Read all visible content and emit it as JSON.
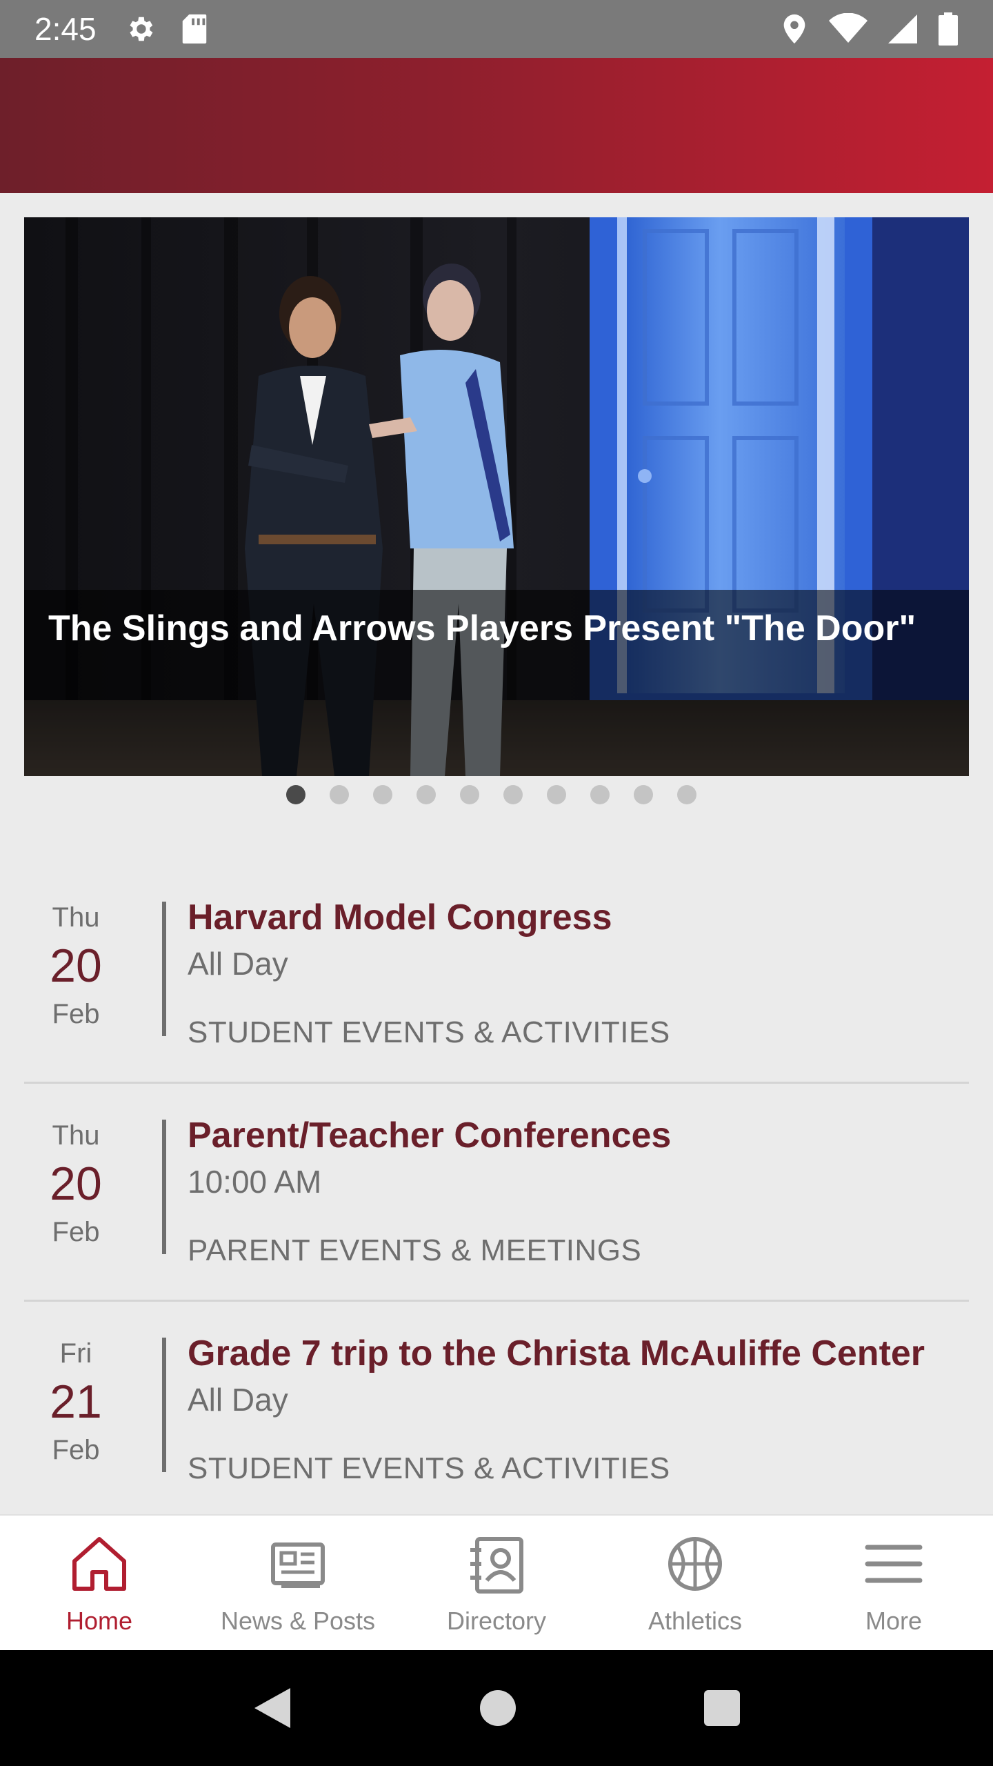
{
  "status_bar": {
    "time": "2:45",
    "left_icons": [
      "gear-icon",
      "sd-card-icon"
    ],
    "right_icons": [
      "location-icon",
      "wifi-icon",
      "signal-icon",
      "battery-icon"
    ]
  },
  "hero": {
    "caption": "The Slings and Arrows Players Present \"The Door\"",
    "slide_count": 10,
    "active_slide": 1
  },
  "events": [
    {
      "dow": "Thu",
      "day": "20",
      "month": "Feb",
      "title": "Harvard Model Congress",
      "time": "All Day",
      "category": "STUDENT EVENTS & ACTIVITIES"
    },
    {
      "dow": "Thu",
      "day": "20",
      "month": "Feb",
      "title": "Parent/Teacher Conferences",
      "time": "10:00 AM",
      "category": "PARENT EVENTS & MEETINGS"
    },
    {
      "dow": "Fri",
      "day": "21",
      "month": "Feb",
      "title": "Grade 7 trip to the Christa McAuliffe Center",
      "time": "All Day",
      "category": "STUDENT EVENTS & ACTIVITIES"
    }
  ],
  "bottom_nav": {
    "items": [
      {
        "label": "Home",
        "icon": "home-icon",
        "active": true
      },
      {
        "label": "News & Posts",
        "icon": "news-icon",
        "active": false
      },
      {
        "label": "Directory",
        "icon": "directory-icon",
        "active": false
      },
      {
        "label": "Athletics",
        "icon": "basketball-icon",
        "active": false
      },
      {
        "label": "More",
        "icon": "menu-icon",
        "active": false
      }
    ]
  },
  "system_nav": [
    "back-icon",
    "home-circle-icon",
    "recents-icon"
  ],
  "colors": {
    "brand": "#b01e30",
    "event_title": "#6a1f2a",
    "header_gradient_start": "#6e1f2a",
    "header_gradient_end": "#c41f32"
  }
}
